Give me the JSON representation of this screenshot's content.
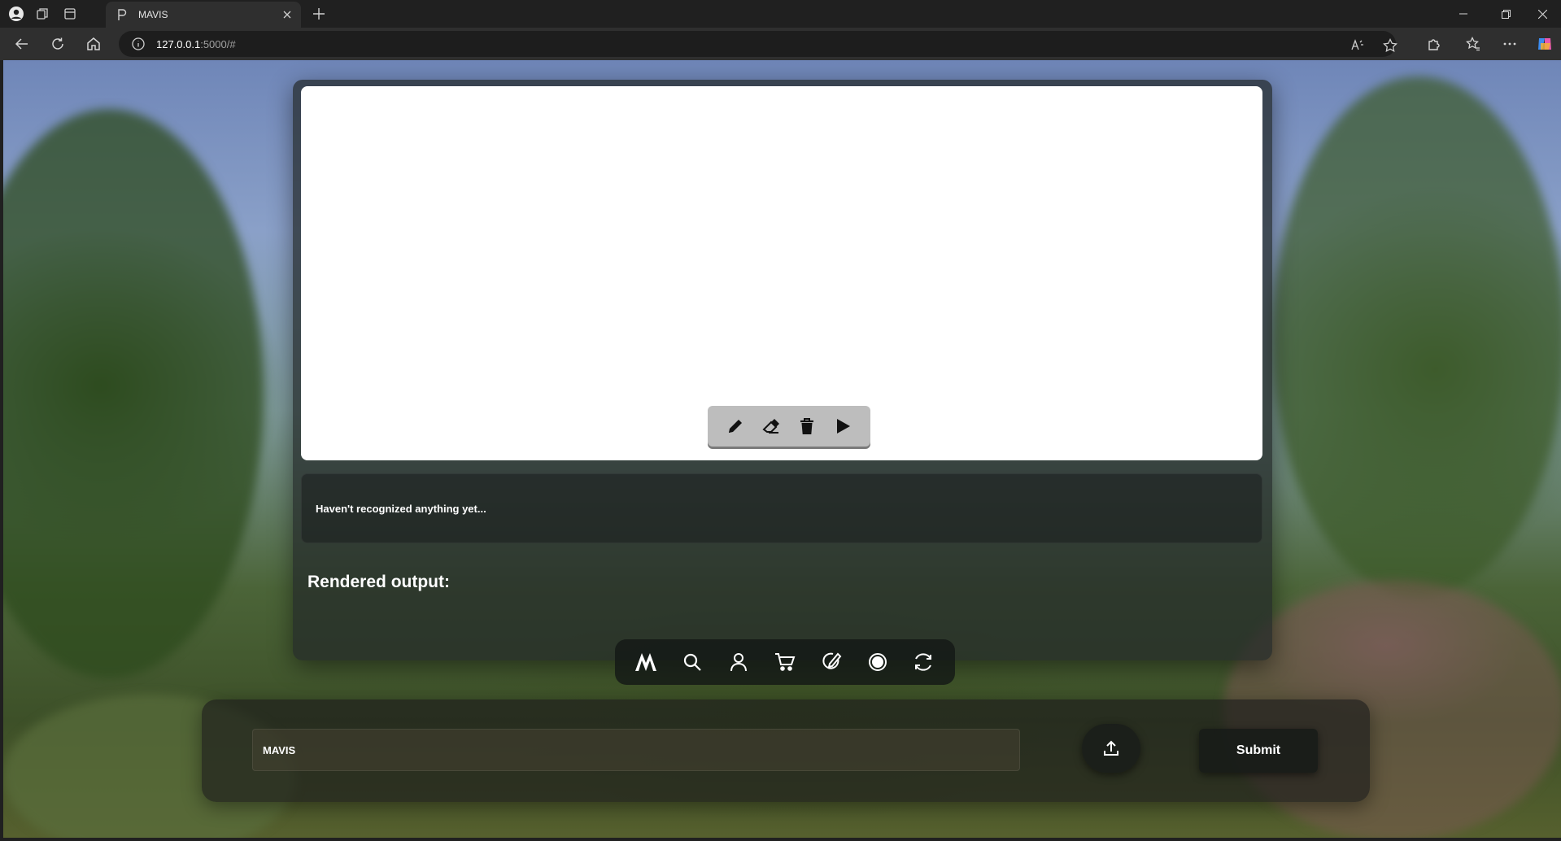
{
  "browser": {
    "tab_title": "MAVIS",
    "url_host": "127.0.0.1",
    "url_rest": ":5000/#"
  },
  "app": {
    "recognition_text": "Haven't recognized anything yet...",
    "rendered_label": "Rendered output:",
    "prompt_value": "MAVIS",
    "submit_label": "Submit"
  },
  "draw_tools": [
    "pencil-icon",
    "eraser-icon",
    "trash-icon",
    "play-icon"
  ],
  "dock_icons": [
    "logo-m-icon",
    "search-icon",
    "user-icon",
    "cart-icon",
    "edit-icon",
    "record-icon",
    "refresh-icon"
  ],
  "colors": {
    "browser_bg": "#202020",
    "toolbar_bg": "#2f2f2f",
    "canvas_bg": "#ffffff",
    "tool_tray": "#bdbdbd"
  }
}
